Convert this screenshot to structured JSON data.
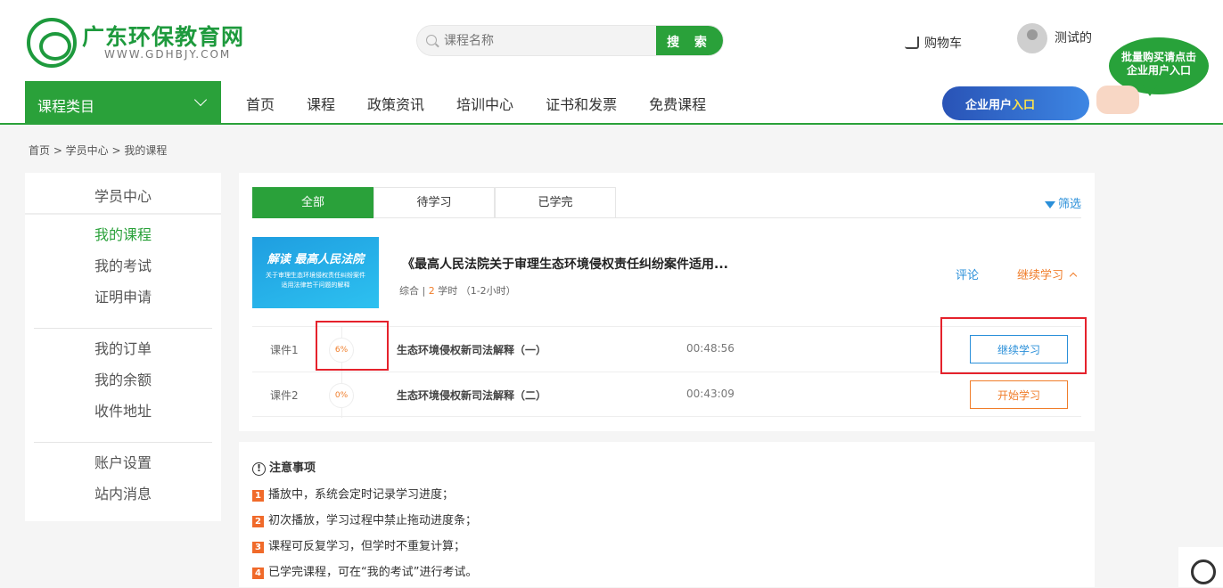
{
  "header": {
    "logo_title": "广东环保教育网",
    "logo_sub": "WWW.GDHBJY.COM",
    "search_placeholder": "课程名称",
    "search_button": "搜 索",
    "cart_label": "购物车",
    "user_name": "测试的",
    "bubble_line1": "批量购买请点击",
    "bubble_line2": "企业用户入口",
    "enterprise_a": "企业用户",
    "enterprise_b": "入口"
  },
  "nav": {
    "category": "课程类目",
    "links": [
      "首页",
      "课程",
      "政策资讯",
      "培训中心",
      "证书和发票",
      "免费课程"
    ]
  },
  "breadcrumb": "首页 > 学员中心 > 我的课程",
  "sidebar": {
    "title": "学员中心",
    "groups": [
      [
        "我的课程",
        "我的考试",
        "证明申请"
      ],
      [
        "我的订单",
        "我的余额",
        "收件地址"
      ],
      [
        "账户设置",
        "站内消息"
      ]
    ]
  },
  "tabs": [
    "全部",
    "待学习",
    "已学完"
  ],
  "filter_label": "筛选",
  "course": {
    "thumb_title": "解读 最高人民法院",
    "thumb_sub1": "关于审理生态环境侵权责任纠纷案件",
    "thumb_sub2": "适用法律若干问题的解释",
    "title": "《最高人民法院关于审理生态环境侵权责任纠纷案件适用...",
    "meta_prefix": "综合 | ",
    "meta_hours": "2",
    "meta_suffix": " 学时 （1-2小时）",
    "comment": "评论",
    "continue": "继续学习"
  },
  "lessons": [
    {
      "label": "课件1",
      "progress": "6%",
      "name": "生态环境侵权新司法解释（一）",
      "duration": "00:48:56",
      "action": "继续学习"
    },
    {
      "label": "课件2",
      "progress": "0%",
      "name": "生态环境侵权新司法解释（二）",
      "duration": "00:43:09",
      "action": "开始学习"
    }
  ],
  "notes": {
    "title": "注意事项",
    "items": [
      "播放中，系统会定时记录学习进度；",
      "初次播放，学习过程中禁止拖动进度条；",
      "课程可反复学习，但学时不重复计算；",
      "已学完课程，可在“我的考试”进行考试。"
    ]
  },
  "colors": {
    "brand": "#2aa13a",
    "link": "#2a8fd9",
    "accent": "#f07d2a",
    "highlight": "#e5222c"
  }
}
